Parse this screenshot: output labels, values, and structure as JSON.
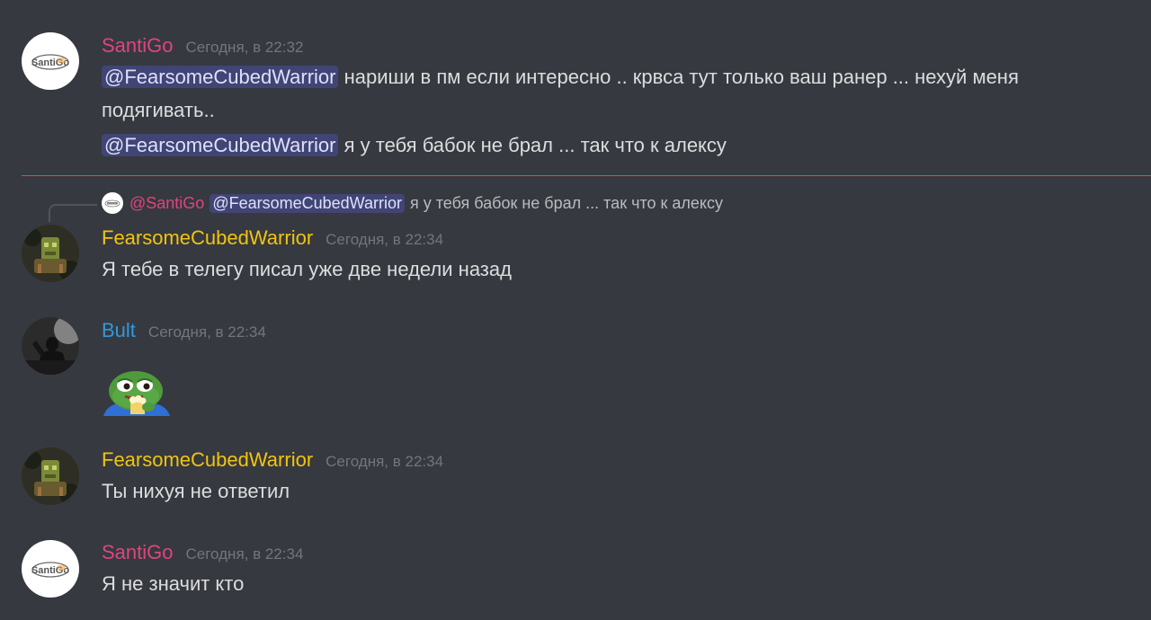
{
  "colors": {
    "background": "#36393f",
    "santigo_name": "#e0447f",
    "fearsome_name": "#f1c40f",
    "bult_name": "#3498db",
    "new_messages_divider": "#ed4245",
    "mention_bg": "#414675"
  },
  "messages": [
    {
      "author": "SantiGo",
      "time": "Сегодня, в 22:32",
      "lines": [
        {
          "mention": "@FearsomeCubedWarrior",
          "text": " нариши в пм если интересно .. крвса тут только ваш ранер ... нехуй меня"
        },
        {
          "text": "подягивать.."
        },
        {
          "mention": "@FearsomeCubedWarrior",
          "text": " я у тебя бабок не брал ... так что  к алексу"
        }
      ]
    },
    {
      "reply": {
        "author": "@SantiGo",
        "mention": "@FearsomeCubedWarrior",
        "text": "я у тебя бабок не брал ... так что  к алексу"
      },
      "author": "FearsomeCubedWarrior",
      "time": "Сегодня, в 22:34",
      "text": "Я тебе в телегу писал уже две недели назад"
    },
    {
      "author": "Bult",
      "time": "Сегодня, в 22:34",
      "sticker": "pepe-popcorn-sticker"
    },
    {
      "author": "FearsomeCubedWarrior",
      "time": "Сегодня, в 22:34",
      "text": "Ты нихуя не ответил"
    },
    {
      "author": "SantiGo",
      "time": "Сегодня, в 22:34",
      "text": "Я не значит кто"
    }
  ],
  "avatar_logo_text": "SantiGo"
}
